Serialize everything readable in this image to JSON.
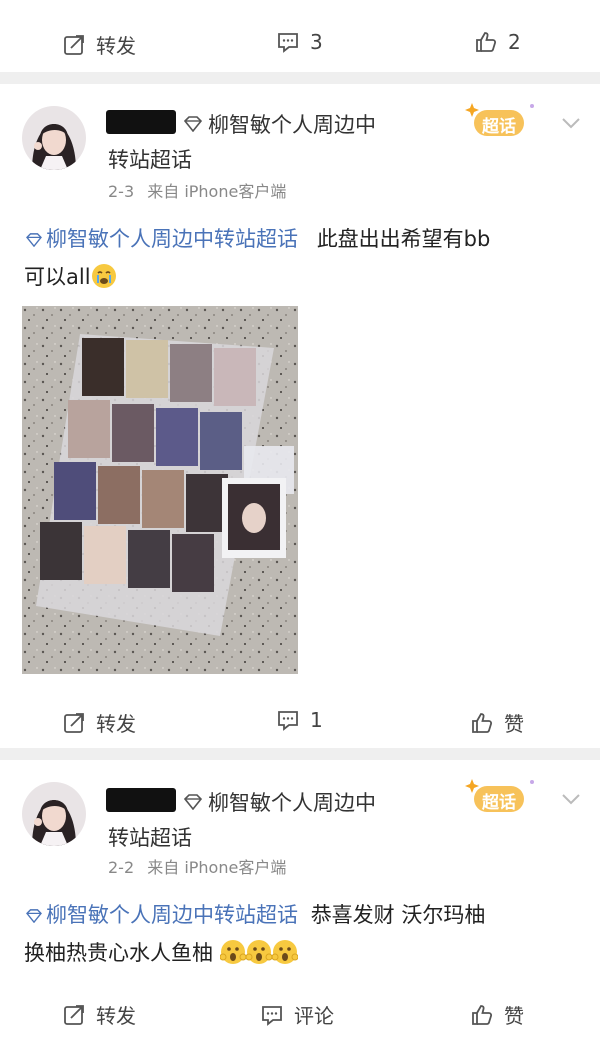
{
  "top_bar": {
    "repost_label": "转发",
    "comment_count": "3",
    "like_count": "2"
  },
  "posts": [
    {
      "topic_name": "柳智敏个人周边中",
      "topic_suffix": "转站超话",
      "time": "2-3",
      "source": "来自 iPhone客户端",
      "badge_label": "超话",
      "body_topic": "柳智敏个人周边中转站超话",
      "body_text_line1": "此盘出出希望有bb",
      "body_text_line2": "可以all",
      "repost_label": "转发",
      "comment_label": "1",
      "like_label": "赞"
    },
    {
      "topic_name": "柳智敏个人周边中",
      "topic_suffix": "转站超话",
      "time": "2-2",
      "source": "来自 iPhone客户端",
      "badge_label": "超话",
      "body_topic": "柳智敏个人周边中转站超话",
      "body_text_line1": "恭喜发财 沃尔玛柚",
      "body_text_line2": "换柚热贵心水人鱼柚",
      "repost_label": "转发",
      "comment_label": "评论",
      "like_label": "赞"
    }
  ],
  "colors": {
    "topic_link": "#4a73b8",
    "badge_orange": "#f5a623"
  }
}
